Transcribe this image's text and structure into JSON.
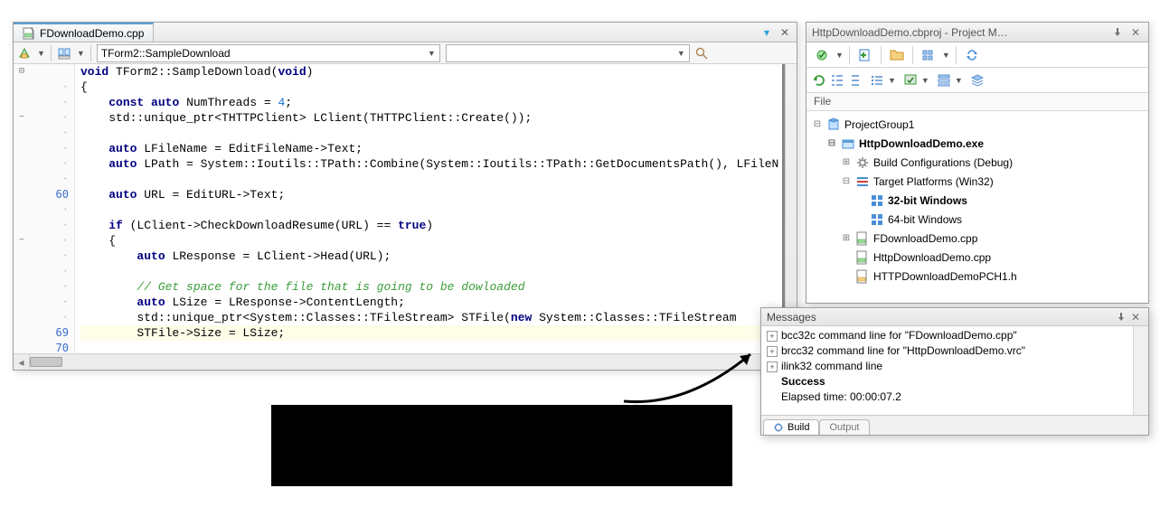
{
  "editor": {
    "tab_label": "FDownloadDemo.cpp",
    "nav_dropdown1": "TForm2::SampleDownload",
    "nav_dropdown2": "",
    "line_numbers_highlight": [
      60,
      69,
      70
    ],
    "lines": [
      {
        "ln": "",
        "fold": "⊟",
        "tokens": [
          [
            "kw",
            "void"
          ],
          [
            "op",
            " TForm2::SampleDownload("
          ],
          [
            "kw",
            "void"
          ],
          [
            "op",
            ")"
          ]
        ]
      },
      {
        "ln": "·",
        "fold": "",
        "tokens": [
          [
            "op",
            "{"
          ]
        ]
      },
      {
        "ln": "·",
        "fold": "",
        "tokens": [
          [
            "op",
            "    "
          ],
          [
            "kw",
            "const"
          ],
          [
            "op",
            " "
          ],
          [
            "kw",
            "auto"
          ],
          [
            "op",
            " NumThreads = "
          ],
          [
            "num",
            "4"
          ],
          [
            "op",
            ";"
          ]
        ]
      },
      {
        "ln": "·",
        "fold": "—",
        "tokens": [
          [
            "op",
            "    std::unique_ptr<THTTPClient> LClient(THTTPClient::Create());"
          ]
        ]
      },
      {
        "ln": "·",
        "fold": "",
        "tokens": [
          [
            "op",
            ""
          ]
        ]
      },
      {
        "ln": "·",
        "fold": "",
        "tokens": [
          [
            "op",
            "    "
          ],
          [
            "kw",
            "auto"
          ],
          [
            "op",
            " LFileName = EditFileName->Text;"
          ]
        ]
      },
      {
        "ln": "·",
        "fold": "",
        "tokens": [
          [
            "op",
            "    "
          ],
          [
            "kw",
            "auto"
          ],
          [
            "op",
            " LPath = System::Ioutils::TPath::Combine(System::Ioutils::TPath::GetDocumentsPath(), LFileN"
          ]
        ]
      },
      {
        "ln": "·",
        "fold": "",
        "tokens": [
          [
            "op",
            ""
          ]
        ]
      },
      {
        "ln": "60",
        "fold": "",
        "tokens": [
          [
            "op",
            "    "
          ],
          [
            "kw",
            "auto"
          ],
          [
            "op",
            " URL = EditURL->Text;"
          ]
        ]
      },
      {
        "ln": "·",
        "fold": "",
        "tokens": [
          [
            "op",
            ""
          ]
        ]
      },
      {
        "ln": "·",
        "fold": "",
        "tokens": [
          [
            "op",
            "    "
          ],
          [
            "kw",
            "if"
          ],
          [
            "op",
            " (LClient->CheckDownloadResume(URL) == "
          ],
          [
            "kw",
            "true"
          ],
          [
            "op",
            ")"
          ]
        ]
      },
      {
        "ln": "·",
        "fold": "—",
        "tokens": [
          [
            "op",
            "    {"
          ]
        ]
      },
      {
        "ln": "·",
        "fold": "",
        "tokens": [
          [
            "op",
            "        "
          ],
          [
            "kw",
            "auto"
          ],
          [
            "op",
            " LResponse = LClient->Head(URL);"
          ]
        ]
      },
      {
        "ln": "·",
        "fold": "",
        "tokens": [
          [
            "op",
            ""
          ]
        ]
      },
      {
        "ln": "·",
        "fold": "",
        "tokens": [
          [
            "op",
            "        "
          ],
          [
            "cmt",
            "// Get space for the file that is going to be dowloaded"
          ]
        ]
      },
      {
        "ln": "·",
        "fold": "",
        "tokens": [
          [
            "op",
            "        "
          ],
          [
            "kw",
            "auto"
          ],
          [
            "op",
            " LSize = LResponse->ContentLength;"
          ]
        ]
      },
      {
        "ln": "·",
        "fold": "",
        "tokens": [
          [
            "op",
            "        std::unique_ptr<System::Classes::TFileStream> STFile("
          ],
          [
            "kw",
            "new"
          ],
          [
            "op",
            " System::Classes::TFileStream"
          ]
        ]
      },
      {
        "ln": "69",
        "fold": "",
        "hl": true,
        "tokens": [
          [
            "op",
            "        STFile->Size = LSize;"
          ]
        ]
      },
      {
        "ln": "70",
        "fold": "",
        "tokens": [
          [
            "op",
            ""
          ]
        ]
      }
    ]
  },
  "project_manager": {
    "title": "HttpDownloadDemo.cbproj - Project M…",
    "column_header": "File",
    "tree": [
      {
        "indent": 0,
        "tw": "⊟",
        "icon": "proj-group",
        "label": "ProjectGroup1",
        "bold": false
      },
      {
        "indent": 1,
        "tw": "⊟",
        "icon": "exe",
        "label": "HttpDownloadDemo.exe",
        "bold": true
      },
      {
        "indent": 2,
        "tw": "⊞",
        "icon": "gear",
        "label": "Build Configurations (Debug)",
        "bold": false
      },
      {
        "indent": 2,
        "tw": "⊟",
        "icon": "target",
        "label": "Target Platforms (Win32)",
        "bold": false
      },
      {
        "indent": 3,
        "tw": "",
        "icon": "win",
        "label": "32-bit Windows",
        "bold": true
      },
      {
        "indent": 3,
        "tw": "",
        "icon": "win",
        "label": "64-bit Windows",
        "bold": false
      },
      {
        "indent": 2,
        "tw": "⊞",
        "icon": "cpp",
        "label": "FDownloadDemo.cpp",
        "bold": false
      },
      {
        "indent": 2,
        "tw": "",
        "icon": "cpp",
        "label": "HttpDownloadDemo.cpp",
        "bold": false
      },
      {
        "indent": 2,
        "tw": "",
        "icon": "h",
        "label": "HTTPDownloadDemoPCH1.h",
        "bold": false
      }
    ]
  },
  "messages": {
    "title": "Messages",
    "items": [
      {
        "exp": true,
        "text": "bcc32c command line for \"FDownloadDemo.cpp\""
      },
      {
        "exp": true,
        "text": "brcc32 command line for \"HttpDownloadDemo.vrc\""
      },
      {
        "exp": true,
        "text": "ilink32 command line"
      },
      {
        "exp": false,
        "text": "Success",
        "bold": true
      },
      {
        "exp": false,
        "text": "Elapsed time: 00:00:07.2"
      }
    ],
    "tabs": [
      "Build",
      "Output"
    ]
  }
}
